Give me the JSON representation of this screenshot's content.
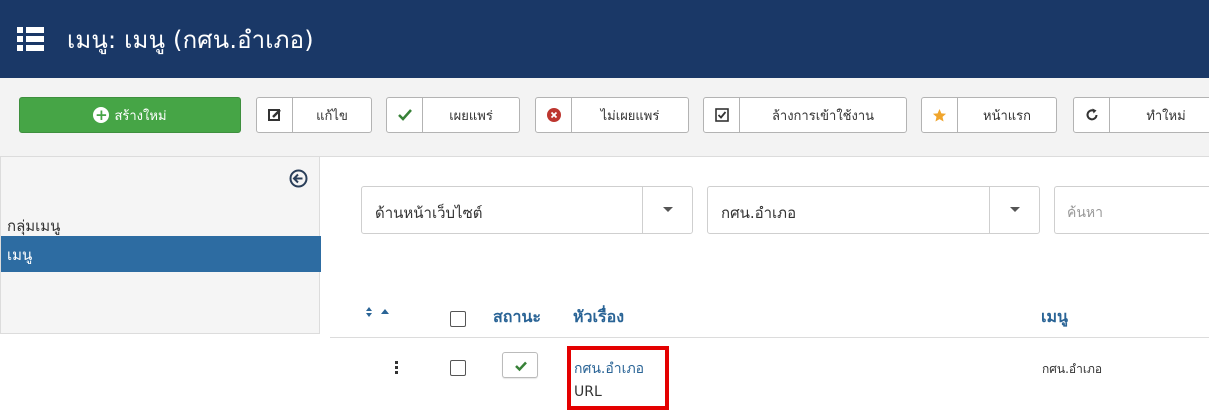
{
  "header": {
    "icon": "list-icon",
    "title": "เมนู: เมนู (กศน.อำเภอ)",
    "color": "#1a3867"
  },
  "toolbar": {
    "new_label": "สร้างใหม่",
    "edit_label": "แก้ไข",
    "publish_label": "เผยแพร่",
    "unpublish_label": "ไม่เผยแพร่",
    "checkin_label": "ล้างการเข้าใช้งาน",
    "home_label": "หน้าแรก",
    "rebuild_label": "ทำใหม่"
  },
  "sidebar": {
    "items": [
      {
        "label": "กลุ่มเมนู",
        "active": false
      },
      {
        "label": "เมนู",
        "active": true
      }
    ]
  },
  "filters": {
    "client_value": "ด้านหน้าเว็บไซต์",
    "menu_value": "กศน.อำเภอ",
    "search_placeholder": "ค้นหา"
  },
  "table": {
    "columns": {
      "status": "สถานะ",
      "title": "หัวเรื่อง",
      "menu": "เมนู"
    },
    "rows": [
      {
        "title": "กศน.อำเภอ",
        "type": "URL",
        "menu": "กศน.อำเภอ",
        "published": true,
        "checked": false
      }
    ]
  },
  "colors": {
    "accent": "#2d6ca2",
    "new_button": "#46a546",
    "highlight": "#e40000"
  }
}
